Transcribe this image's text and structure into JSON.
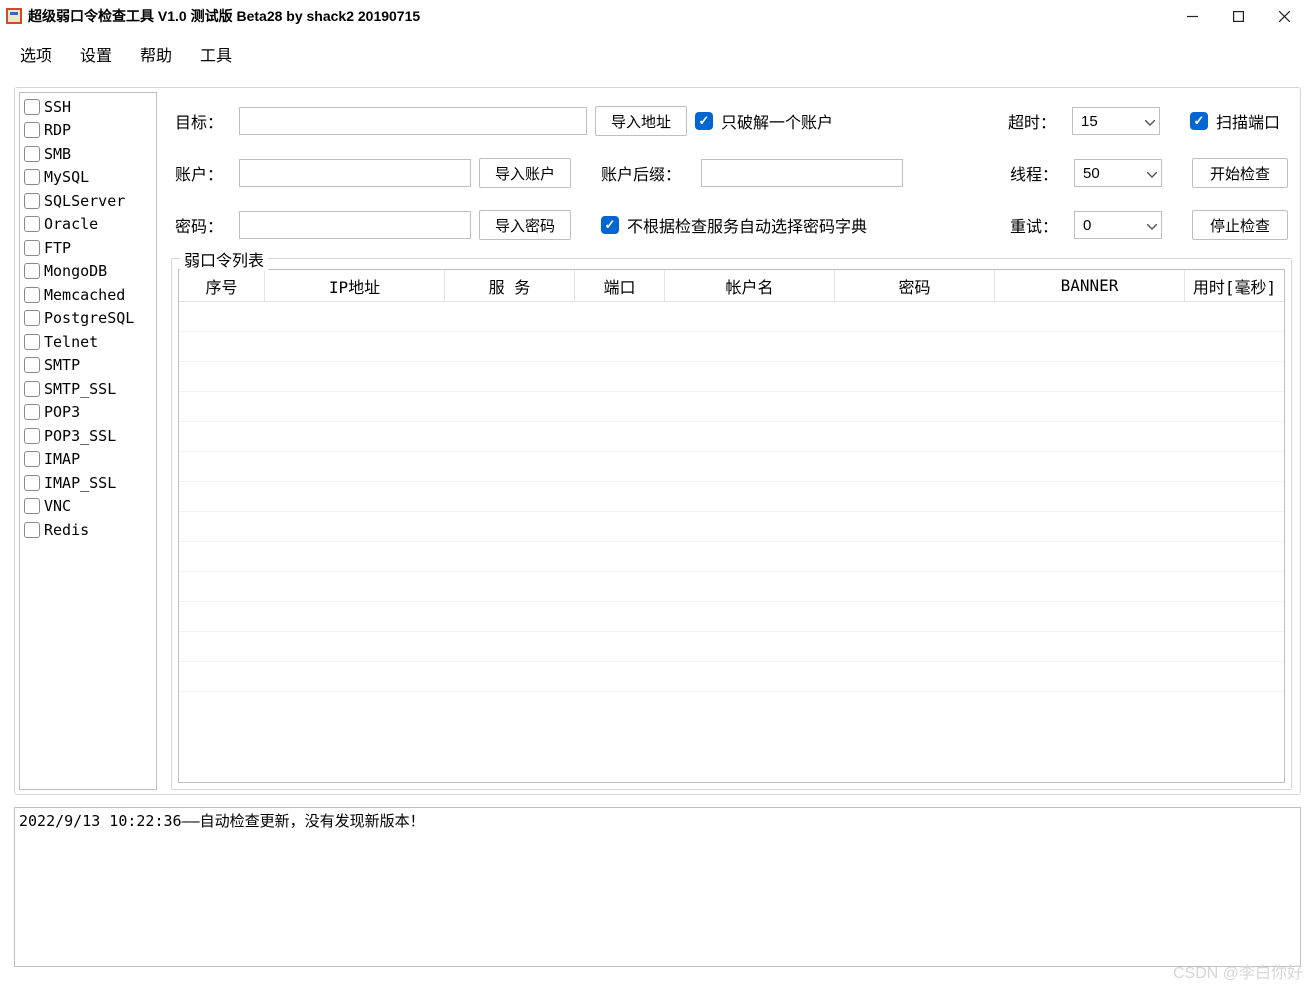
{
  "window": {
    "title": "超级弱口令检查工具 V1.0 测试版 Beta28 by shack2 20190715"
  },
  "menu": {
    "options": "选项",
    "settings": "设置",
    "help": "帮助",
    "tools": "工具"
  },
  "services": [
    "SSH",
    "RDP",
    "SMB",
    "MySQL",
    "SQLServer",
    "Oracle",
    "FTP",
    "MongoDB",
    "Memcached",
    "PostgreSQL",
    "Telnet",
    "SMTP",
    "SMTP_SSL",
    "POP3",
    "POP3_SSL",
    "IMAP",
    "IMAP_SSL",
    "VNC",
    "Redis"
  ],
  "config": {
    "target_label": "目标：",
    "target_value": "",
    "import_target": "导入地址",
    "only_one_account": "只破解一个账户",
    "timeout_label": "超时：",
    "timeout_value": "15",
    "scan_port": "扫描端口",
    "user_label": "账户：",
    "user_value": "",
    "import_user": "导入账户",
    "suffix_label": "账户后缀：",
    "suffix_value": "",
    "threads_label": "线程：",
    "threads_value": "50",
    "start_button": "开始检查",
    "pass_label": "密码：",
    "pass_value": "",
    "import_pass": "导入密码",
    "no_auto_dict": "不根据检查服务自动选择密码字典",
    "retry_label": "重试：",
    "retry_value": "0",
    "stop_button": "停止检查"
  },
  "group": {
    "title": "弱口令列表"
  },
  "columns": {
    "seq": "序号",
    "ip": "IP地址",
    "service": "服 务",
    "port": "端口",
    "account": "帐户名",
    "password": "密码",
    "banner": "BANNER",
    "elapsed": "用时[毫秒]"
  },
  "log": {
    "line1": "2022/9/13 10:22:36——自动检查更新，没有发现新版本！"
  },
  "watermark": "CSDN @李白你好"
}
